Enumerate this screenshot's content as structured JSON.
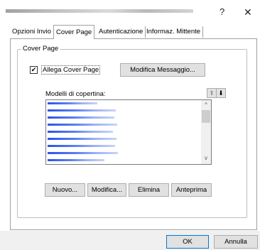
{
  "window": {
    "help_glyph": "?",
    "close_glyph": "✕"
  },
  "tabs": [
    {
      "label": "Opzioni Invio"
    },
    {
      "label": "Cover Page"
    },
    {
      "label": "Autenticazione"
    },
    {
      "label": "Informaz. Mittente"
    }
  ],
  "active_tab": "Cover Page",
  "cover_page": {
    "group_title": "Cover Page",
    "attach_checkbox": {
      "label": "Allega Cover Page",
      "checked": true,
      "glyph": "✔"
    },
    "edit_message_button": "Modifica Messaggio...",
    "templates_label": "Modelli di copertina:",
    "move_up_glyph": "⬆",
    "move_down_glyph": "⬇",
    "scroll_up_glyph": "^",
    "scroll_down_glyph": "v",
    "buttons": {
      "new": "Nuovo...",
      "edit": "Modifica...",
      "delete": "Elimina",
      "preview": "Anteprima"
    }
  },
  "footer": {
    "ok": "OK",
    "cancel": "Annulla"
  },
  "colors": {
    "accent": "#0078d7",
    "list_item_blur": "#2a54e8"
  }
}
